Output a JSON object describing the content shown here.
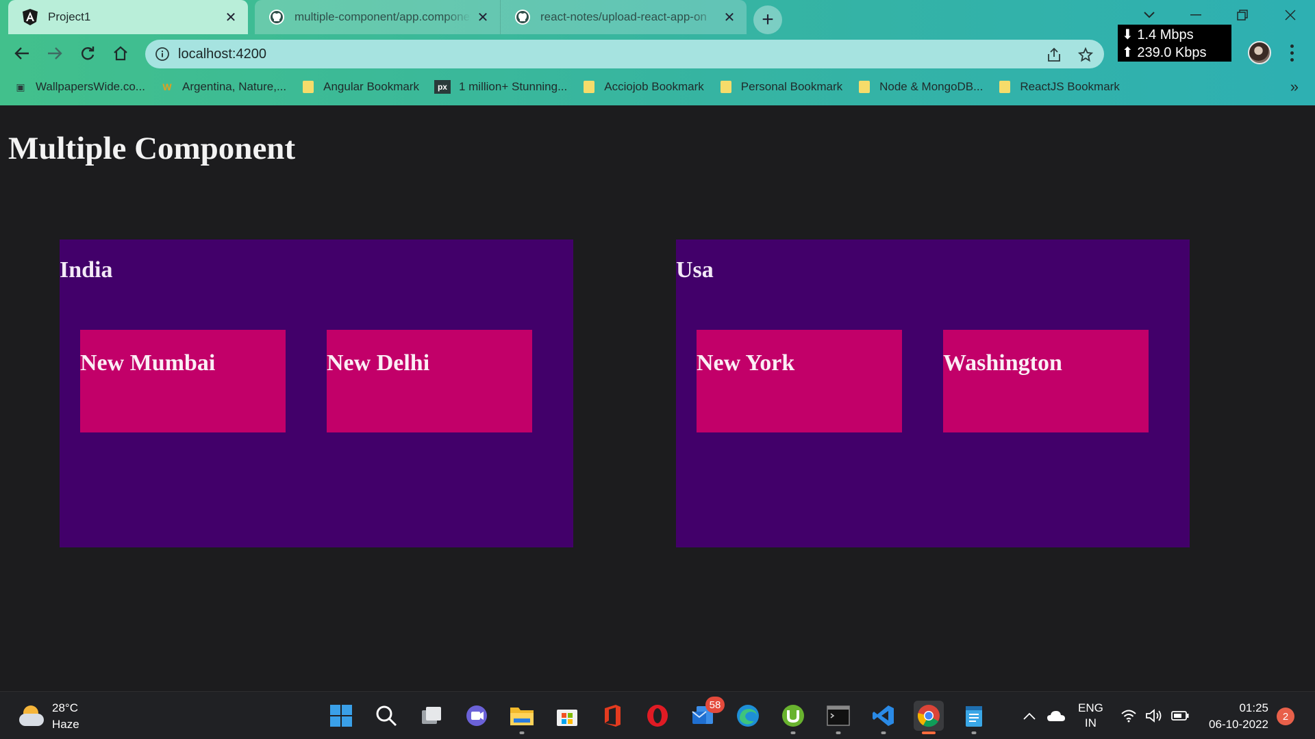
{
  "browser": {
    "tabs": [
      {
        "title": "Project1",
        "icon": "angular-icon",
        "active": true
      },
      {
        "title": "multiple-component/app.component",
        "icon": "github-icon",
        "active": false
      },
      {
        "title": "react-notes/upload-react-app-on",
        "icon": "github-icon",
        "active": false
      }
    ],
    "url": "localhost:4200",
    "network_speed": {
      "down": "1.4 Mbps",
      "up": "239.0 Kbps"
    },
    "bookmarks": [
      {
        "label": "WallpapersWide.co...",
        "icon": "wallpaperswide-icon"
      },
      {
        "label": "Argentina, Nature,...",
        "icon": "w-icon"
      },
      {
        "label": "Angular Bookmark",
        "icon": "folder-icon"
      },
      {
        "label": "1 million+ Stunning...",
        "icon": "pexels-icon"
      },
      {
        "label": "Acciojob Bookmark",
        "icon": "folder-icon"
      },
      {
        "label": "Personal Bookmark",
        "icon": "folder-icon"
      },
      {
        "label": "Node & MongoDB...",
        "icon": "folder-icon"
      },
      {
        "label": "ReactJS Bookmark",
        "icon": "folder-icon"
      }
    ],
    "more_bookmarks": "»"
  },
  "page": {
    "title": "Multiple Component",
    "countries": [
      {
        "name": "India",
        "cities": [
          "New Mumbai",
          "New Delhi"
        ]
      },
      {
        "name": "Usa",
        "cities": [
          "New York",
          "Washington"
        ]
      }
    ]
  },
  "colors": {
    "page_background": "#1c1c1e",
    "country_box": "#42006a",
    "city_box": "#c20069",
    "chrome_accent": "#42c08c"
  },
  "taskbar": {
    "weather": {
      "temp": "28°C",
      "condition": "Haze"
    },
    "apps": [
      "windows-start-icon",
      "search-icon",
      "task-view-icon",
      "chat-icon",
      "file-explorer-icon",
      "microsoft-store-icon",
      "office-icon",
      "opera-icon",
      "mail-icon",
      "edge-icon",
      "utorrent-icon",
      "terminal-icon",
      "vscode-icon",
      "chrome-icon",
      "notepad-icon"
    ],
    "mail_badge": "58",
    "language": {
      "line1": "ENG",
      "line2": "IN"
    },
    "time": "01:25",
    "date": "06-10-2022",
    "notifications": "2"
  }
}
